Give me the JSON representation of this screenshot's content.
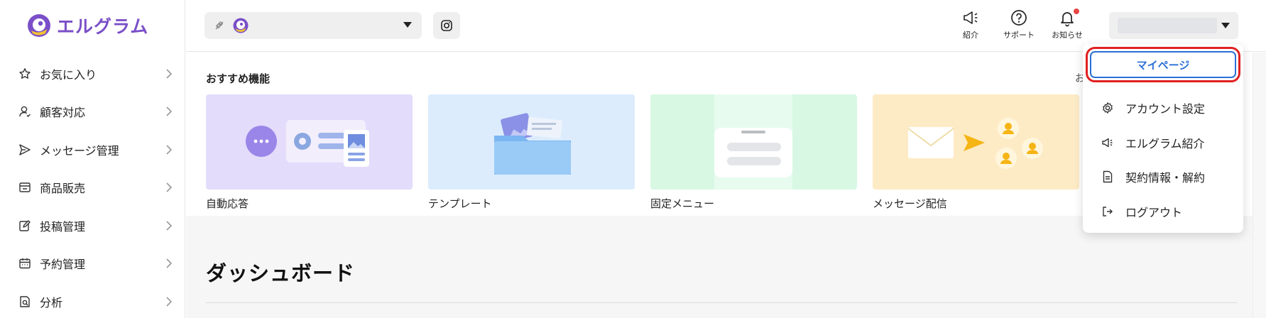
{
  "brand": {
    "name": "エルグラム",
    "color": "#7a4fc8"
  },
  "sidebar": {
    "items": [
      {
        "label": "お気に入り",
        "icon": "star-icon"
      },
      {
        "label": "顧客対応",
        "icon": "user-icon"
      },
      {
        "label": "メッセージ管理",
        "icon": "send-icon"
      },
      {
        "label": "商品販売",
        "icon": "shop-icon"
      },
      {
        "label": "投稿管理",
        "icon": "edit-icon"
      },
      {
        "label": "予約管理",
        "icon": "calendar-icon"
      },
      {
        "label": "分析",
        "icon": "report-icon"
      }
    ]
  },
  "header": {
    "tools": [
      {
        "label": "紹介",
        "icon": "megaphone-icon"
      },
      {
        "label": "サポート",
        "icon": "help-icon"
      },
      {
        "label": "お知らせ",
        "icon": "bell-icon"
      }
    ]
  },
  "recommended": {
    "title": "おすすめ機能",
    "more": "お",
    "cards": [
      {
        "label": "自動応答",
        "bg": "#e3dcfb"
      },
      {
        "label": "テンプレート",
        "bg": "#dcecfd"
      },
      {
        "label": "固定メニュー",
        "bg": "#d8f8e4"
      },
      {
        "label": "メッセージ配信",
        "bg": "#fdebc6"
      }
    ]
  },
  "dashboard": {
    "title": "ダッシュボード"
  },
  "dropdown": {
    "mypage": "マイページ",
    "items": [
      {
        "label": "アカウント設定",
        "icon": "gear-icon"
      },
      {
        "label": "エルグラム紹介",
        "icon": "megaphone-icon"
      },
      {
        "label": "契約情報・解約",
        "icon": "document-icon"
      },
      {
        "label": "ログアウト",
        "icon": "logout-icon"
      }
    ]
  },
  "colors": {
    "accent": "#2a6fd6",
    "highlight": "#e02020",
    "notification": "#e84545"
  }
}
